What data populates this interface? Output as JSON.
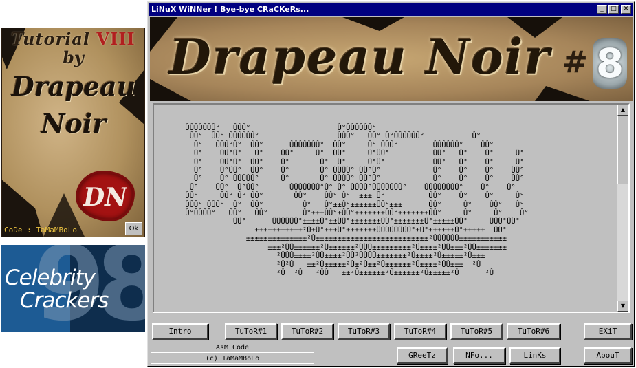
{
  "splash": {
    "title_line1": "Tutorial",
    "title_roman": "VIII",
    "title_by": "by",
    "name_line1": "Drapeau",
    "name_line2": "Noir",
    "seal_text": "DN",
    "credit": "CoDe : TaMaMBoLo",
    "ok_label": "Ok"
  },
  "celebrity": {
    "number": "98",
    "line1": "Celebrity",
    "line2": "Crackers"
  },
  "window": {
    "title": "LiNuX WiNNer ! Bye-bye CRaCKeRs...",
    "minimize_label": "_",
    "maximize_label": "□",
    "close_label": "✕"
  },
  "banner": {
    "title": "Drapeau Noir",
    "hash": "#",
    "number": "8"
  },
  "text_area": {
    "ascii_art": "    ÛÛÛÛÛÛÛ°   ÛÛÛ°                    Û°ÛÛÛÛÛÛ°\n     ÛÛ°  ÛÛ° ÛÛÛÛÛÛ°                  ÛÛÛ°   ÛÛ° Û°ÛÛÛÛÛÛ°           Û°\n      Û°   ÛÛÛ°Û°  ÛÛ°      ÛÛÛÛÛÛÛ°  ÛÛ°     Û° ÛÛÛ°        ÛÛÛÛÛÛ°    ÛÛ°\n      Û°    ÛÛ°Û°   Û°    ÛÛ°     Û°  ÛÛ°     Û°ÛÛ°          ÛÛ°   Û°    Û°     Û°\n      Û°    ÛÛ°Û°  ÛÛ°    Û°       Û°  Û°     Û°Û°           ÛÛ°   Û°    Û°     Û°\n      Û°    Û°ÛÛ°  ÛÛ°    Û°       Û° ÛÛÛÛ° ÛÛ°Û°            Û°    Û°    Û°    ÛÛ°\n      Û°    Û° ÛÛÛÛÛ°     Û°       Û° ÛÛÛÛ° ÛÛ°Û°            Û°    Û°    Û°    ÛÛ°\n     Û°    ÛÛ°  Û°ÛÛ°       ÛÛÛÛÛÛÛ°Û° Û° ÛÛÛÛ°ÛÛÛÛÛÛÛ°    ÛÛÛÛÛÛÛÛ°    Û°    Û°\n    ÛÛ°     ÛÛ° Û° ÛÛ°       ÛÛ°    ÛÛ° Û°  ±±± Û°          ÛÛ°    Û°    Û°     Û°\n    ÛÛÛ° ÛÛÛ°  Û°  ÛÛ°         Û°   Û°±±Û°±±±±±±ÛÛ°±±±      ÛÛ°     Û°    ÛÛ°   Û°\n    Û°ÛÛÛÛ°   ÛÛ°   ÛÛ°        Û°±±±ÛÛ°±ÛÛ°±±±±±±±ÛÛ°±±±±±±±ÛÛ°     Û°     Û°    Û°\n               ÛÛ°      ÛÛÛÛÛÛ°±±±±Û°±±ÛÛ°±±±±±±±ÛÛ°±±±±±±±Û°±±±±±ÛÛ°     ÛÛÛ°ÛÛ°\n                    ±±±±±±±±±±±²Û±Û°±±±Û°±±±±±±±ÛÛÛÛÛÛÛÛ°±Û°±±±±±±Û°±±±±±  ÛÛ°\n                  ±±±±±±±±±±±±±±²Û±±±±±±±±±±±±±±±±±±±±±±±±±±²ÛÛÛÛÛÛ±±±±±±±±±±±\n                       ±±±²ÛÛ±±±±±±²Û±±±±±±²ÛÛÛ±±±±±±±±±²Û±±±±²ÛÛ±±±²ÛÛ±±±±±±±\n                         ²ÛÛÛ±±±±²ÛÛ±±±±²ÛÛ²ÛÛÛÛ±±±±±±±²Û±±±±²Û±±±±±²Û±±±\n                         ²Û²Û   ±±²Û±±±±±²Û±²Û±±²Û±±±±±±²Û±±±±²ÛÛ±±±  ²Û\n                         ²Û  ²Û   ²ÛÛ   ±±²Û±±±±±±²Û±±±±±±²Û±±±±±²Û      ²Û"
  },
  "buttons": {
    "intro": "Intro",
    "tutor1": "TuToR#1",
    "tutor2": "TuToR#2",
    "tutor3": "TuToR#3",
    "tutor4": "TuToR#4",
    "tutor5": "TuToR#5",
    "tutor6": "TuToR#6",
    "exit": "EXiT",
    "greetz": "GReeTz",
    "nfo": "NFo...",
    "links": "LinKs",
    "about": "AbouT"
  },
  "status": {
    "line1": "AsM Code",
    "line2": "(c) TaMaMBoLo"
  }
}
